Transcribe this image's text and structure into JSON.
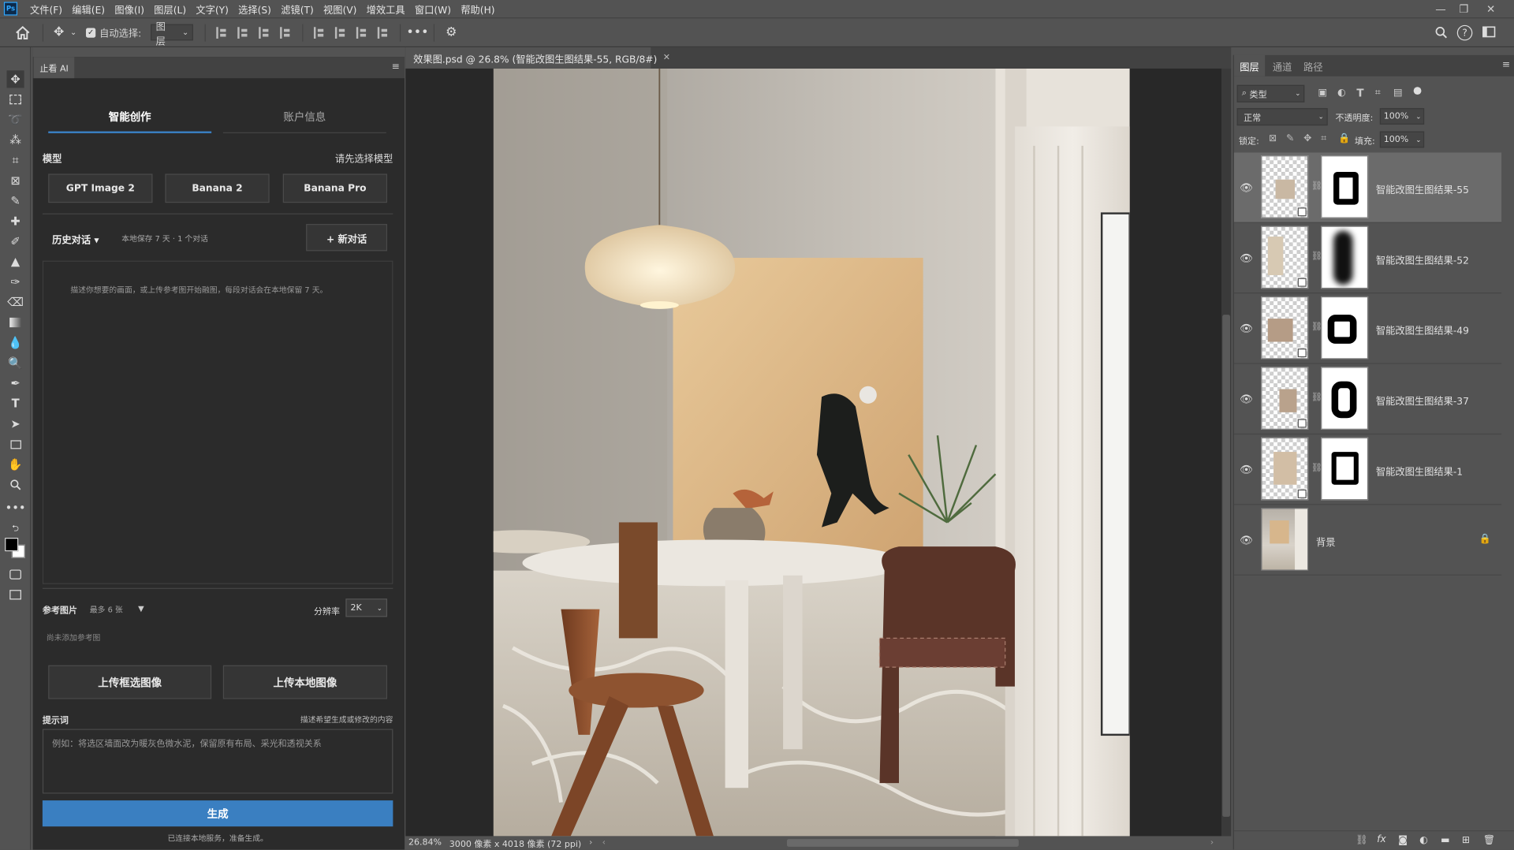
{
  "menubar": {
    "logo": "Ps",
    "items": [
      "文件(F)",
      "编辑(E)",
      "图像(I)",
      "图层(L)",
      "文字(Y)",
      "选择(S)",
      "滤镜(T)",
      "视图(V)",
      "增效工具",
      "窗口(W)",
      "帮助(H)"
    ]
  },
  "optionsbar": {
    "auto_select_label": "自动选择:",
    "auto_select_checked": true,
    "target_value": "图层",
    "more": "•••"
  },
  "plugin": {
    "tab_label": "止看 AI",
    "tabs": [
      "智能创作",
      "账户信息"
    ],
    "model_label": "模型",
    "model_hint": "请先选择模型",
    "models": [
      "GPT Image 2",
      "Banana 2",
      "Banana Pro"
    ],
    "history_label": "历史对话 ▾",
    "history_info": "本地保存 7 天 · 1 个对话",
    "new_chat_label": "+  新对话",
    "chat_placeholder": "描述你想要的画面，或上传参考图开始融图，每段对话会在本地保留 7 天。",
    "ref_label": "参考图片",
    "ref_limit": "最多 6 张",
    "ref_arrow": "▼",
    "resolution_label": "分辨率",
    "resolution_value": "2K",
    "ref_empty": "尚未添加参考图",
    "upload_selection_label": "上传框选图像",
    "upload_local_label": "上传本地图像",
    "prompt_label": "提示词",
    "prompt_hint": "描述希望生成或修改的内容",
    "prompt_placeholder": "例如：将选区墙面改为暖灰色微水泥，保留原有布局、采光和透视关系",
    "generate_label": "生成",
    "status_text": "已连接本地服务，准备生成。"
  },
  "document": {
    "tab_title": "效果图.psd @ 26.8% (智能改图生图结果-55, RGB/8#)",
    "zoom": "26.84%",
    "doc_info": "3000 像素 x 4018 像素 (72 ppi)"
  },
  "layers": {
    "tabs": [
      "图层",
      "通道",
      "路径"
    ],
    "filter_kind": "类型",
    "blend_mode": "正常",
    "opacity_label": "不透明度:",
    "opacity_value": "100%",
    "lock_label": "锁定:",
    "fill_label": "填充:",
    "fill_value": "100%",
    "items": [
      {
        "name": "智能改图生图结果-55",
        "selected": true
      },
      {
        "name": "智能改图生图结果-52",
        "selected": false
      },
      {
        "name": "智能改图生图结果-49",
        "selected": false
      },
      {
        "name": "智能改图生图结果-37",
        "selected": false
      },
      {
        "name": "智能改图生图结果-1",
        "selected": false
      },
      {
        "name": "背景",
        "selected": false
      }
    ]
  },
  "colors": {
    "accent_blue": "#3a7fc1",
    "panel_bg": "#535353",
    "plugin_bg": "#2b2b2b",
    "selected_layer": "#6b6b6b"
  }
}
